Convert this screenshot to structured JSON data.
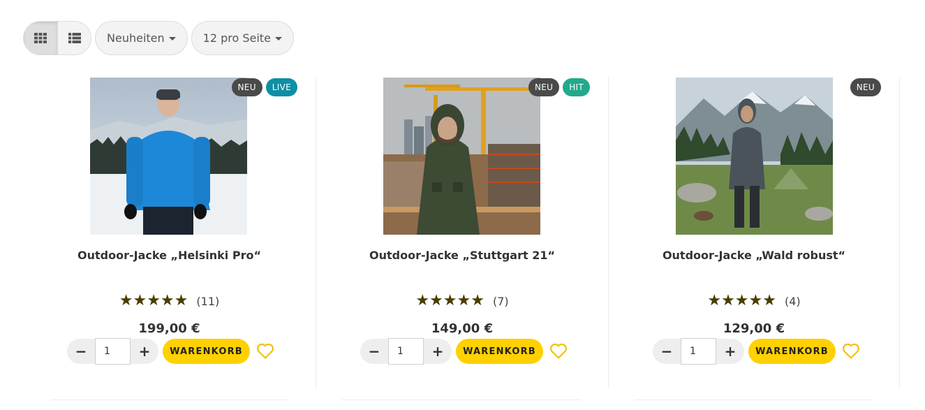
{
  "toolbar": {
    "views": [
      {
        "icon": "grid-view-icon",
        "active": true
      },
      {
        "icon": "list-view-icon",
        "active": false
      }
    ],
    "sort": {
      "label": "Neuheiten"
    },
    "per_page": {
      "label": "12 pro Seite"
    }
  },
  "products": [
    {
      "title": "Outdoor-Jacke „Helsinki Pro“",
      "badges": [
        "NEU",
        "LIVE"
      ],
      "stars": "★★★★★",
      "reviews": "(11)",
      "price": "199,00 €",
      "qty": "1",
      "cart_label": "WARENKORB"
    },
    {
      "title": "Outdoor-Jacke „Stuttgart 21“",
      "badges": [
        "NEU",
        "HIT"
      ],
      "stars": "★★★★★",
      "reviews": "(7)",
      "price": "149,00 €",
      "qty": "1",
      "cart_label": "WARENKORB"
    },
    {
      "title": "Outdoor-Jacke „Wald robust“",
      "badges": [
        "NEU"
      ],
      "stars": "★★★★★",
      "reviews": "(4)",
      "price": "129,00 €",
      "qty": "1",
      "cart_label": "WARENKORB"
    }
  ],
  "qty_controls": {
    "minus": "−",
    "plus": "+"
  },
  "colors": {
    "accent": "#ffd100",
    "badge_neu": "#4a4a4a",
    "badge_live": "#0e8fa6",
    "badge_hit": "#22a98c",
    "stars": "#4a3d00"
  }
}
